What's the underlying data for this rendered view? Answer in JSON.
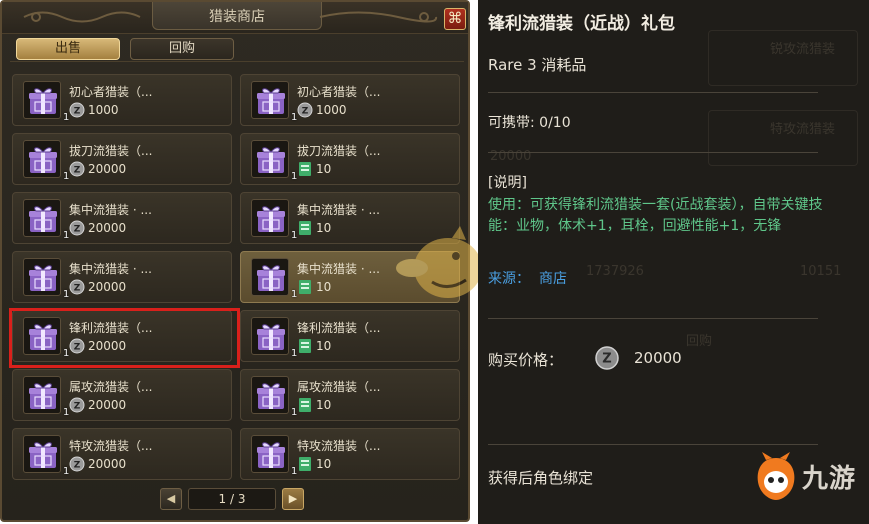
{
  "shop": {
    "title": "猎装商店",
    "close_glyph": "⌘",
    "tabs": [
      {
        "label": "出售",
        "active": true
      },
      {
        "label": "回购",
        "active": false
      }
    ],
    "items": [
      {
        "name": "初心者猎装（...",
        "price": "1000",
        "currency": "zenny",
        "qty": "1"
      },
      {
        "name": "初心者猎装（...",
        "price": "1000",
        "currency": "zenny",
        "qty": "1"
      },
      {
        "name": "拔刀流猎装（...",
        "price": "20000",
        "currency": "zenny",
        "qty": "1"
      },
      {
        "name": "拔刀流猎装（...",
        "price": "10",
        "currency": "ticket",
        "qty": "1"
      },
      {
        "name": "集中流猎装 · ...",
        "price": "20000",
        "currency": "zenny",
        "qty": "1"
      },
      {
        "name": "集中流猎装 · ...",
        "price": "10",
        "currency": "ticket",
        "qty": "1"
      },
      {
        "name": "集中流猎装 · ...",
        "price": "20000",
        "currency": "zenny",
        "qty": "1"
      },
      {
        "name": "集中流猎装 · ...",
        "price": "10",
        "currency": "ticket",
        "qty": "1",
        "highlighted": true
      },
      {
        "name": "锋利流猎装（...",
        "price": "20000",
        "currency": "zenny",
        "qty": "1",
        "selected": true
      },
      {
        "name": "锋利流猎装（...",
        "price": "10",
        "currency": "ticket",
        "qty": "1"
      },
      {
        "name": "属攻流猎装（...",
        "price": "20000",
        "currency": "zenny",
        "qty": "1"
      },
      {
        "name": "属攻流猎装（...",
        "price": "10",
        "currency": "ticket",
        "qty": "1"
      },
      {
        "name": "特攻流猎装（...",
        "price": "20000",
        "currency": "zenny",
        "qty": "1"
      },
      {
        "name": "特攻流猎装（...",
        "price": "10",
        "currency": "ticket",
        "qty": "1"
      }
    ],
    "pager": {
      "prev": "◀",
      "page": "1 / 3",
      "next": "▶"
    }
  },
  "tooltip": {
    "title": "锋利流猎装（近战）礼包",
    "rarity": "Rare 3  消耗品",
    "carry": "可携带: 0/10",
    "desc_head": "[说明]",
    "desc_body": "使用：可获得锋利流猎装一套(近战套装），自带关键技能：业物，体术+1，耳栓，回避性能+1，无锋",
    "source_label": "来源：",
    "source_value": "商店",
    "price_label": "购买价格：",
    "price": "20000",
    "bind_note": "获得后角色绑定",
    "ghost_texts": [
      "锐攻流猎装",
      "特攻流猎装",
      "20000",
      "1737926",
      "10151",
      "回购"
    ]
  },
  "watermark": {
    "brand": "九游"
  },
  "colors": {
    "zenny": "#9a9a9a",
    "ticket": "#3fae6a",
    "item_purple": "#8a63c4",
    "desc_green": "#5fc68a",
    "source_blue": "#4a9ee0",
    "selection_red": "#d9201b"
  }
}
